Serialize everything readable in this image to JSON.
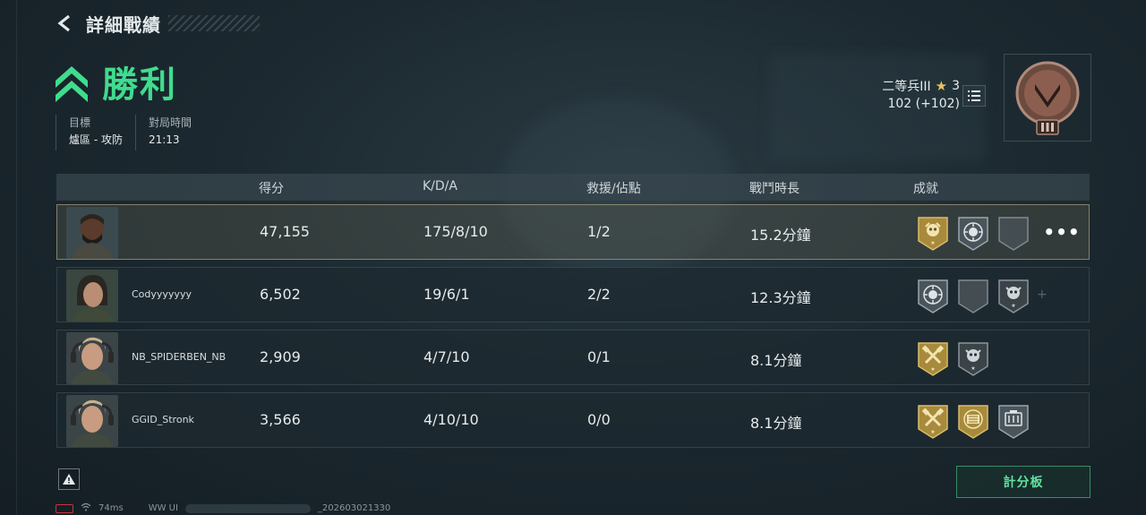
{
  "header": {
    "title": "詳細戰績"
  },
  "result": {
    "label": "勝利",
    "color": "#3fdc8e"
  },
  "meta": {
    "objective_label": "目標",
    "objective_value": "爐區 - 攻防",
    "time_label": "對局時間",
    "time_value": "21:13"
  },
  "rank": {
    "name": "二等兵III",
    "stars": "3",
    "points": "102 (+102)"
  },
  "table": {
    "headers": [
      "得分",
      "K/D/A",
      "救援/佔點",
      "戰鬥時長",
      "成就"
    ],
    "rows": [
      {
        "name": "",
        "score": "47,155",
        "kda": "175/8/10",
        "rescue": "1/2",
        "duration": "15.2分鐘",
        "achievements": [
          "gold-skull-badge",
          "skull-target-badge",
          "empty-badge"
        ],
        "highlighted": true
      },
      {
        "name": "Codyyyyyyy",
        "score": "6,502",
        "kda": "19/6/1",
        "rescue": "2/2",
        "duration": "12.3分鐘",
        "achievements": [
          "skull-target-badge",
          "empty-badge",
          "dark-skull-badge"
        ]
      },
      {
        "name": "NB_SPIDERBEN_NB",
        "score": "2,909",
        "kda": "4/7/10",
        "rescue": "0/1",
        "duration": "8.1分鐘",
        "achievements": [
          "gold-hammer-badge",
          "dark-skull-badge"
        ]
      },
      {
        "name": "GGID_Stronk",
        "score": "3,566",
        "kda": "4/10/10",
        "rescue": "0/0",
        "duration": "8.1分鐘",
        "achievements": [
          "gold-hammer-badge",
          "gold-crate-badge",
          "crate-badge"
        ]
      }
    ]
  },
  "footer": {
    "scoreboard_label": "計分板",
    "ping": "74ms",
    "build_prefix": "WW UI",
    "build_suffix": "_202603021330"
  }
}
